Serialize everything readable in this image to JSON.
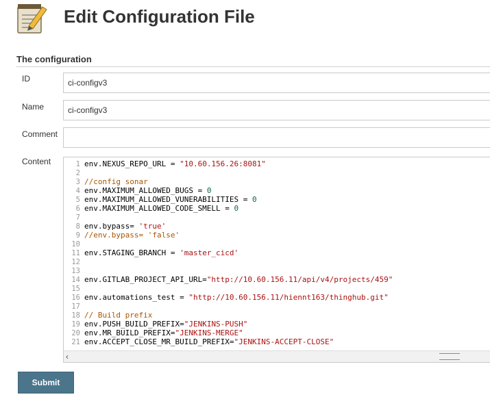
{
  "header": {
    "icon": "notepad-pencil-icon",
    "title": "Edit Configuration File"
  },
  "section": {
    "title": "The configuration"
  },
  "form": {
    "id_label": "ID",
    "id_value": "ci-configv3",
    "name_label": "Name",
    "name_value": "ci-configv3",
    "comment_label": "Comment",
    "comment_value": "",
    "content_label": "Content"
  },
  "editor": {
    "lines": [
      {
        "n": "1",
        "tokens": [
          {
            "t": "env.NEXUS_REPO_URL = ",
            "c": "plain"
          },
          {
            "t": "\"10.60.156.26:8081\"",
            "c": "str"
          }
        ]
      },
      {
        "n": "2",
        "tokens": []
      },
      {
        "n": "3",
        "tokens": [
          {
            "t": "//config sonar",
            "c": "comment"
          }
        ]
      },
      {
        "n": "4",
        "tokens": [
          {
            "t": "env.MAXIMUM_ALLOWED_BUGS = ",
            "c": "plain"
          },
          {
            "t": "0",
            "c": "num"
          }
        ]
      },
      {
        "n": "5",
        "tokens": [
          {
            "t": "env.MAXIMUM_ALLOWED_VUNERABILITIES = ",
            "c": "plain"
          },
          {
            "t": "0",
            "c": "num"
          }
        ]
      },
      {
        "n": "6",
        "tokens": [
          {
            "t": "env.MAXIMUM_ALLOWED_CODE_SMELL = ",
            "c": "plain"
          },
          {
            "t": "0",
            "c": "num"
          }
        ]
      },
      {
        "n": "7",
        "tokens": []
      },
      {
        "n": "8",
        "tokens": [
          {
            "t": "env.bypass= ",
            "c": "plain"
          },
          {
            "t": "'true'",
            "c": "str"
          }
        ]
      },
      {
        "n": "9",
        "tokens": [
          {
            "t": "//env.bypass= 'false'",
            "c": "comment"
          }
        ]
      },
      {
        "n": "10",
        "tokens": []
      },
      {
        "n": "11",
        "tokens": [
          {
            "t": "env.STAGING_BRANCH = ",
            "c": "plain"
          },
          {
            "t": "'master_cicd'",
            "c": "str"
          }
        ]
      },
      {
        "n": "12",
        "tokens": []
      },
      {
        "n": "13",
        "tokens": []
      },
      {
        "n": "14",
        "tokens": [
          {
            "t": "env.GITLAB_PROJECT_API_URL=",
            "c": "plain"
          },
          {
            "t": "\"http://10.60.156.11/api/v4/projects/459\"",
            "c": "str"
          }
        ]
      },
      {
        "n": "15",
        "tokens": []
      },
      {
        "n": "16",
        "tokens": [
          {
            "t": "env.automations_test = ",
            "c": "plain"
          },
          {
            "t": "\"http://10.60.156.11/hiennt163/thinghub.git\"",
            "c": "str"
          }
        ]
      },
      {
        "n": "17",
        "tokens": []
      },
      {
        "n": "18",
        "tokens": [
          {
            "t": "// Build prefix",
            "c": "comment"
          }
        ]
      },
      {
        "n": "19",
        "tokens": [
          {
            "t": "env.PUSH_BUILD_PREFIX=",
            "c": "plain"
          },
          {
            "t": "\"JENKINS-PUSH\"",
            "c": "str"
          }
        ]
      },
      {
        "n": "20",
        "tokens": [
          {
            "t": "env.MR_BUILD_PREFIX=",
            "c": "plain"
          },
          {
            "t": "\"JENKINS-MERGE\"",
            "c": "str"
          }
        ]
      },
      {
        "n": "21",
        "tokens": [
          {
            "t": "env.ACCEPT_CLOSE_MR_BUILD_PREFIX=",
            "c": "plain"
          },
          {
            "t": "\"JENKINS-ACCEPT-CLOSE\"",
            "c": "str"
          }
        ]
      }
    ],
    "scroll_left_icon": "chevron-left-icon"
  },
  "actions": {
    "submit_label": "Submit"
  },
  "colors": {
    "submit_bg": "#4b758b",
    "string": "#aa1111",
    "number": "#116644",
    "comment": "#aa5500"
  }
}
